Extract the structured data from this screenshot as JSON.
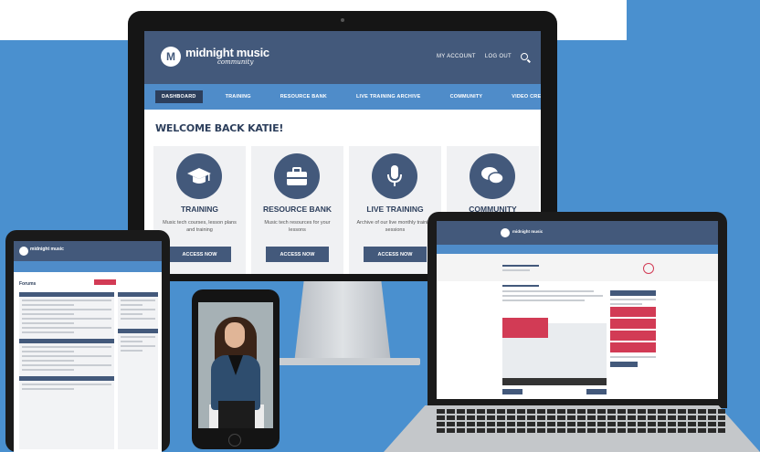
{
  "monitor": {
    "brand": {
      "name": "midnight music",
      "sub": "community",
      "logo_letter": "M"
    },
    "toplinks": [
      "MY ACCOUNT",
      "LOG OUT"
    ],
    "nav": [
      "DASHBOARD",
      "TRAINING",
      "RESOURCE BANK",
      "LIVE TRAINING ARCHIVE",
      "COMMUNITY",
      "VIDEO CREATION COURSE"
    ],
    "nav_active_index": 0,
    "welcome": "WELCOME BACK KATIE!",
    "cards": [
      {
        "icon": "graduation-cap-icon",
        "title": "TRAINING",
        "desc": "Music tech courses, lesson plans and training",
        "button": "ACCESS NOW"
      },
      {
        "icon": "briefcase-icon",
        "title": "RESOURCE BANK",
        "desc": "Music tech resources for your lessons",
        "button": "ACCESS NOW"
      },
      {
        "icon": "microphone-icon",
        "title": "LIVE TRAINING",
        "desc": "Archive of our live monthly training sessions",
        "button": "ACCESS NOW"
      },
      {
        "icon": "chat-bubbles-icon",
        "title": "COMMUNITY",
        "desc": "",
        "button": ""
      }
    ]
  },
  "tablet": {
    "brand": "midnight music",
    "section_title": "Forums"
  },
  "laptop": {
    "brand": "midnight music",
    "page_title": "ABOUT THIS MODULE"
  },
  "colors": {
    "background": "#4a90cf",
    "header": "#43597b",
    "nav": "#4f8cc9",
    "accent": "#d23b55"
  }
}
